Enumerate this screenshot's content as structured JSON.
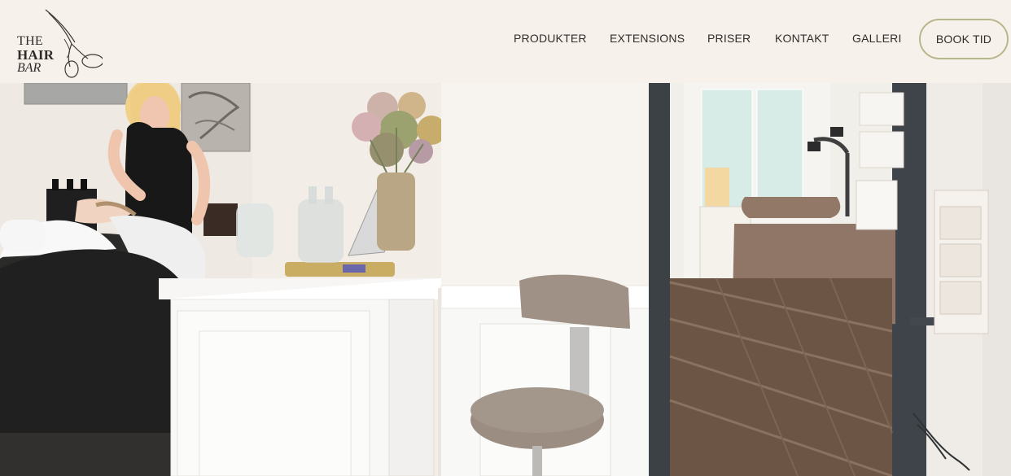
{
  "logo": {
    "line1": "THE",
    "line2": "HAIR",
    "line3": "BAR"
  },
  "nav": {
    "items": [
      {
        "label": "PRODUKTER"
      },
      {
        "label": "EXTENSIONS"
      },
      {
        "label": "PRISER"
      },
      {
        "label": "KONTAKT"
      },
      {
        "label": "GALLERI"
      }
    ],
    "book_label": "BOOK TID"
  },
  "colors": {
    "header_bg": "#f7f1ec",
    "accent_border": "#b9b68b",
    "text": "#2f2c29"
  }
}
